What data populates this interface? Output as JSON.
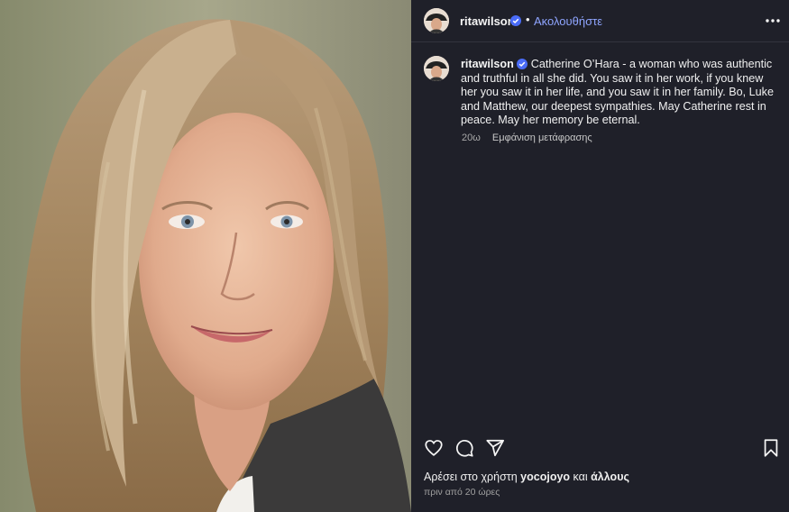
{
  "photo": {
    "alt_subject": "portrait"
  },
  "header": {
    "username": "ritawilson",
    "separator": "•",
    "follow_label": "Ακολουθήστε"
  },
  "comment": {
    "username": "ritawilson",
    "text": "Catherine O’Hara - a woman who was authentic and truthful in all she did. You saw it in her work, if you knew her you saw it in her life, and you saw it in her family. Bo, Luke and Matthew, our deepest sympathies. May Catherine rest in peace. May her memory be eternal.",
    "age": "20ω",
    "see_translation": "Εμφάνιση μετάφρασης"
  },
  "likes": {
    "prefix": "Αρέσει στο χρήστη",
    "user": "yocojoyo",
    "mid": "και",
    "others": "άλλους"
  },
  "timestamp": "πριν από 20 ώρες",
  "colors": {
    "accent": "#8fa5ff",
    "verified": "#4a6cf7",
    "background": "#1f2029"
  },
  "icons": [
    "verified-badge-icon",
    "more-options-icon",
    "heart-icon",
    "comment-icon",
    "share-icon",
    "bookmark-icon"
  ]
}
